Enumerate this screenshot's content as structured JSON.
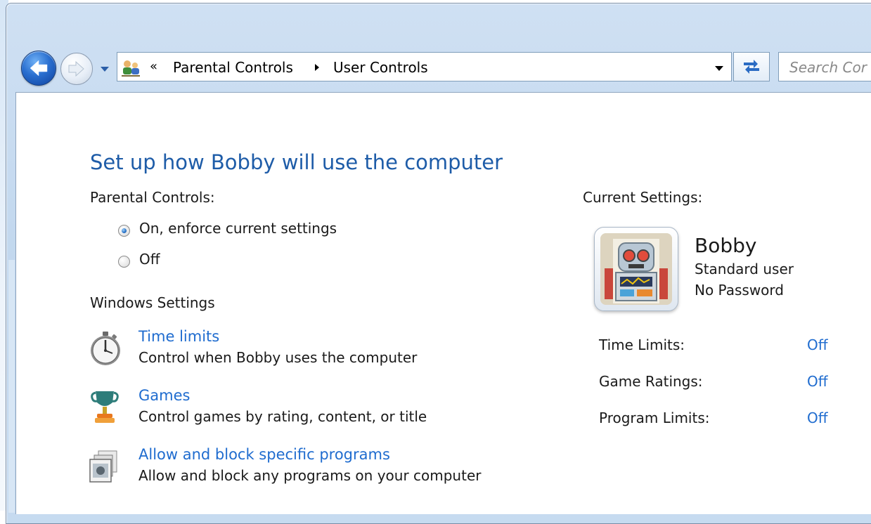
{
  "nav": {
    "overflow_chevron": "«",
    "breadcrumbs": [
      "Parental Controls",
      "User Controls"
    ],
    "search_placeholder": "Search Cor"
  },
  "main": {
    "title": "Set up how Bobby will use the computer",
    "parental_controls_label": "Parental Controls:",
    "options": [
      "On, enforce current settings",
      "Off"
    ],
    "selected_option": "On, enforce current settings",
    "windows_settings_label": "Windows Settings",
    "settings": [
      {
        "icon": "stopwatch-icon",
        "link": "Time limits",
        "description": "Control when Bobby uses the computer"
      },
      {
        "icon": "trophy-icon",
        "link": "Games",
        "description": "Control games by rating, content, or title"
      },
      {
        "icon": "programs-icon",
        "link": "Allow and block specific programs",
        "description": "Allow and block any programs on your computer"
      }
    ]
  },
  "current": {
    "label": "Current Settings:",
    "user_name": "Bobby",
    "user_type": "Standard user",
    "password_status": "No Password",
    "avatar": "robot-avatar",
    "status": [
      {
        "name": "Time Limits:",
        "value": "Off"
      },
      {
        "name": "Game Ratings:",
        "value": "Off"
      },
      {
        "name": "Program Limits:",
        "value": "Off"
      }
    ]
  },
  "colors": {
    "title": "#1e5ca8",
    "link": "#1f6ccf"
  }
}
